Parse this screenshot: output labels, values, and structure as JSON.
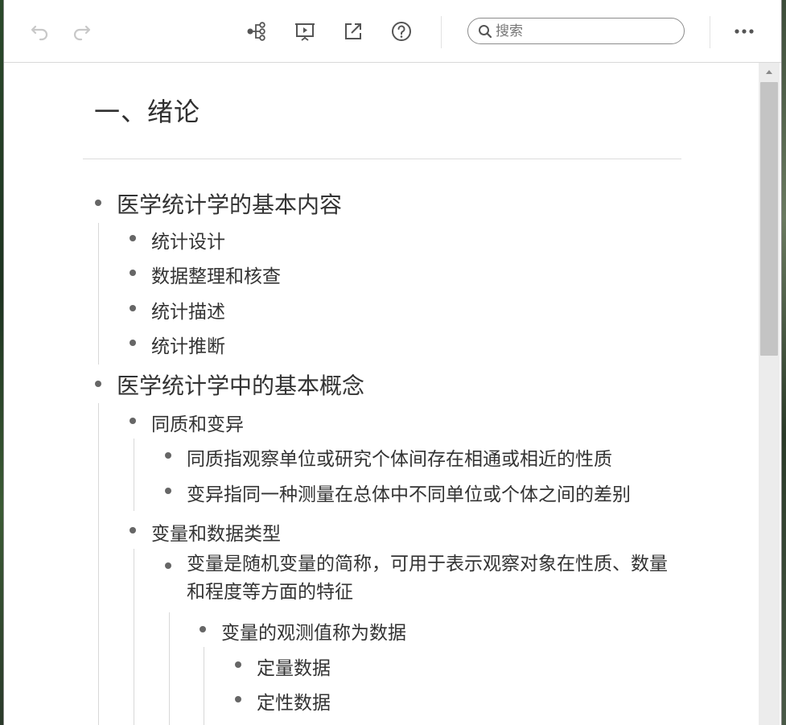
{
  "toolbar": {
    "search_placeholder": "搜索",
    "icons": [
      "undo-icon",
      "redo-icon",
      "mindmap-icon",
      "presentation-icon",
      "export-icon",
      "help-icon",
      "more-icon"
    ]
  },
  "document": {
    "title": "一、绪论",
    "outline": {
      "n1": "医学统计学的基本内容",
      "n1_1": "统计设计",
      "n1_2": "数据整理和核查",
      "n1_3": "统计描述",
      "n1_4": "统计推断",
      "n2": "医学统计学中的基本概念",
      "n2_1": "同质和变异",
      "n2_1_1": "同质指观察单位或研究个体间存在相通或相近的性质",
      "n2_1_2": "变异指同一种测量在总体中不同单位或个体之间的差别",
      "n2_2": "变量和数据类型",
      "n2_2_1": "变量是随机变量的简称，可用于表示观察对象在性质、数量和程度等方面的特征",
      "n2_2_1_1": "变量的观测值称为数据",
      "n2_2_1_1_1": "定量数据",
      "n2_2_1_1_2": "定性数据"
    }
  },
  "colors": {
    "text": "#333333",
    "bullet": "#666666",
    "guide_line": "#d8d8d8",
    "icon": "#555555",
    "icon_disabled": "#c8c8c8"
  }
}
